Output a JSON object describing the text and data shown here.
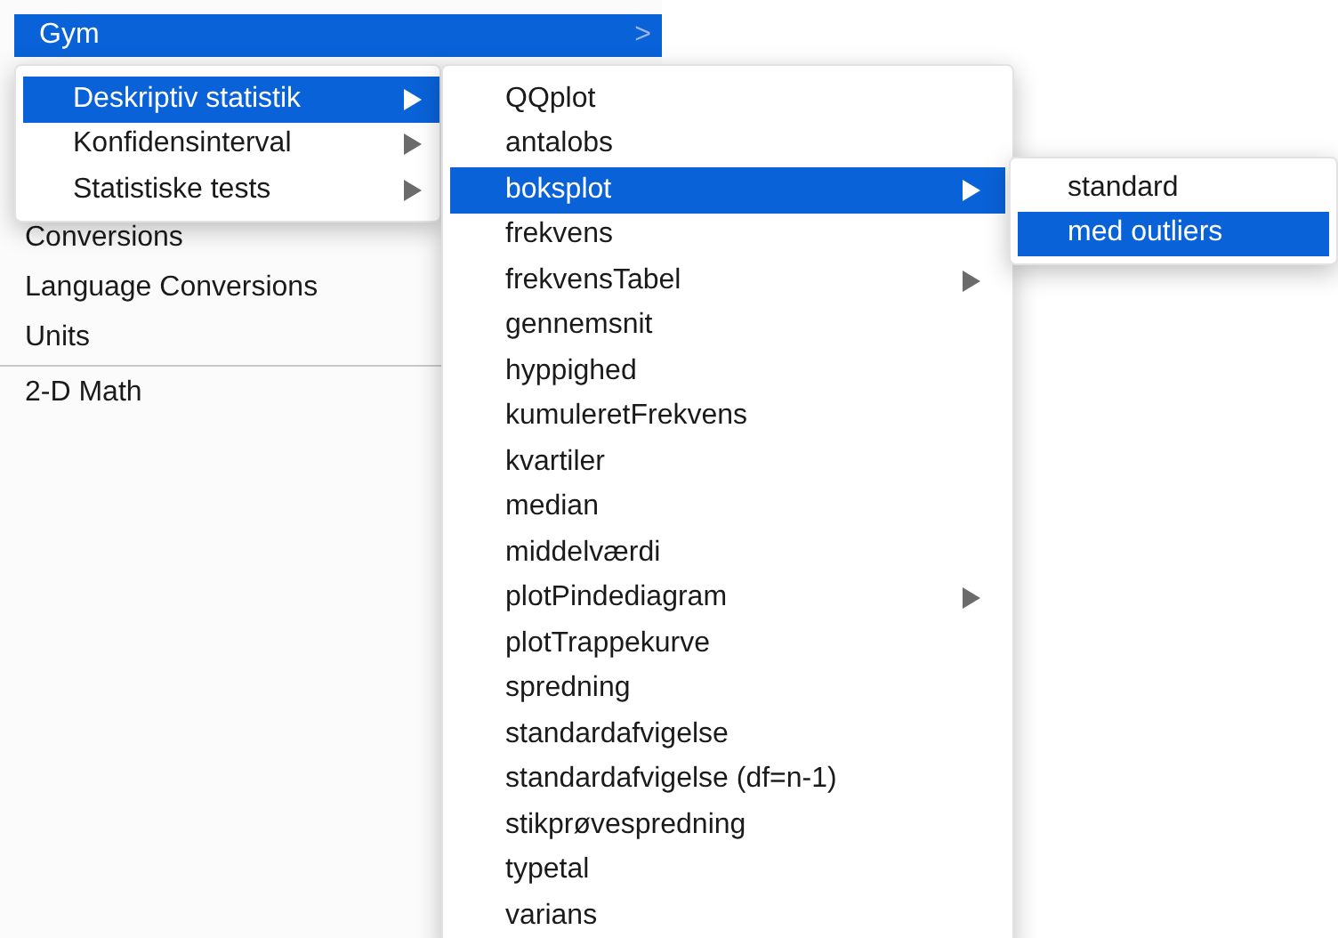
{
  "base_menu": {
    "items": [
      {
        "kind": "item",
        "label": "Gym",
        "selected": true,
        "arrow": ">"
      },
      {
        "kind": "item",
        "label": "Conversions",
        "selected": false
      },
      {
        "kind": "item",
        "label": "Language Conversions",
        "selected": false
      },
      {
        "kind": "item",
        "label": "Units",
        "selected": false
      },
      {
        "kind": "separator"
      },
      {
        "kind": "item",
        "label": "2-D Math",
        "selected": false
      }
    ]
  },
  "submenus": [
    {
      "items": [
        {
          "label": "Deskriptiv statistik",
          "selected": true,
          "has_submenu": true
        },
        {
          "label": "Konfidensinterval",
          "selected": false,
          "has_submenu": true
        },
        {
          "label": "Statistiske tests",
          "selected": false,
          "has_submenu": true
        }
      ]
    },
    {
      "items": [
        {
          "label": "QQplot",
          "selected": false,
          "has_submenu": false
        },
        {
          "label": "antalobs",
          "selected": false,
          "has_submenu": false
        },
        {
          "label": "boksplot",
          "selected": true,
          "has_submenu": true
        },
        {
          "label": "frekvens",
          "selected": false,
          "has_submenu": false
        },
        {
          "label": "frekvensTabel",
          "selected": false,
          "has_submenu": true
        },
        {
          "label": "gennemsnit",
          "selected": false,
          "has_submenu": false
        },
        {
          "label": "hyppighed",
          "selected": false,
          "has_submenu": false
        },
        {
          "label": "kumuleretFrekvens",
          "selected": false,
          "has_submenu": false
        },
        {
          "label": "kvartiler",
          "selected": false,
          "has_submenu": false
        },
        {
          "label": "median",
          "selected": false,
          "has_submenu": false
        },
        {
          "label": "middelværdi",
          "selected": false,
          "has_submenu": false
        },
        {
          "label": "plotPindediagram",
          "selected": false,
          "has_submenu": true
        },
        {
          "label": "plotTrappekurve",
          "selected": false,
          "has_submenu": false
        },
        {
          "label": "spredning",
          "selected": false,
          "has_submenu": false
        },
        {
          "label": "standardafvigelse",
          "selected": false,
          "has_submenu": false
        },
        {
          "label": "standardafvigelse (df=n-1)",
          "selected": false,
          "has_submenu": false
        },
        {
          "label": "stikprøvespredning",
          "selected": false,
          "has_submenu": false
        },
        {
          "label": "typetal",
          "selected": false,
          "has_submenu": false
        },
        {
          "label": "varians",
          "selected": false,
          "has_submenu": false
        }
      ]
    },
    {
      "items": [
        {
          "label": "standard",
          "selected": false,
          "has_submenu": false
        },
        {
          "label": "med outliers",
          "selected": true,
          "has_submenu": false
        }
      ]
    }
  ]
}
